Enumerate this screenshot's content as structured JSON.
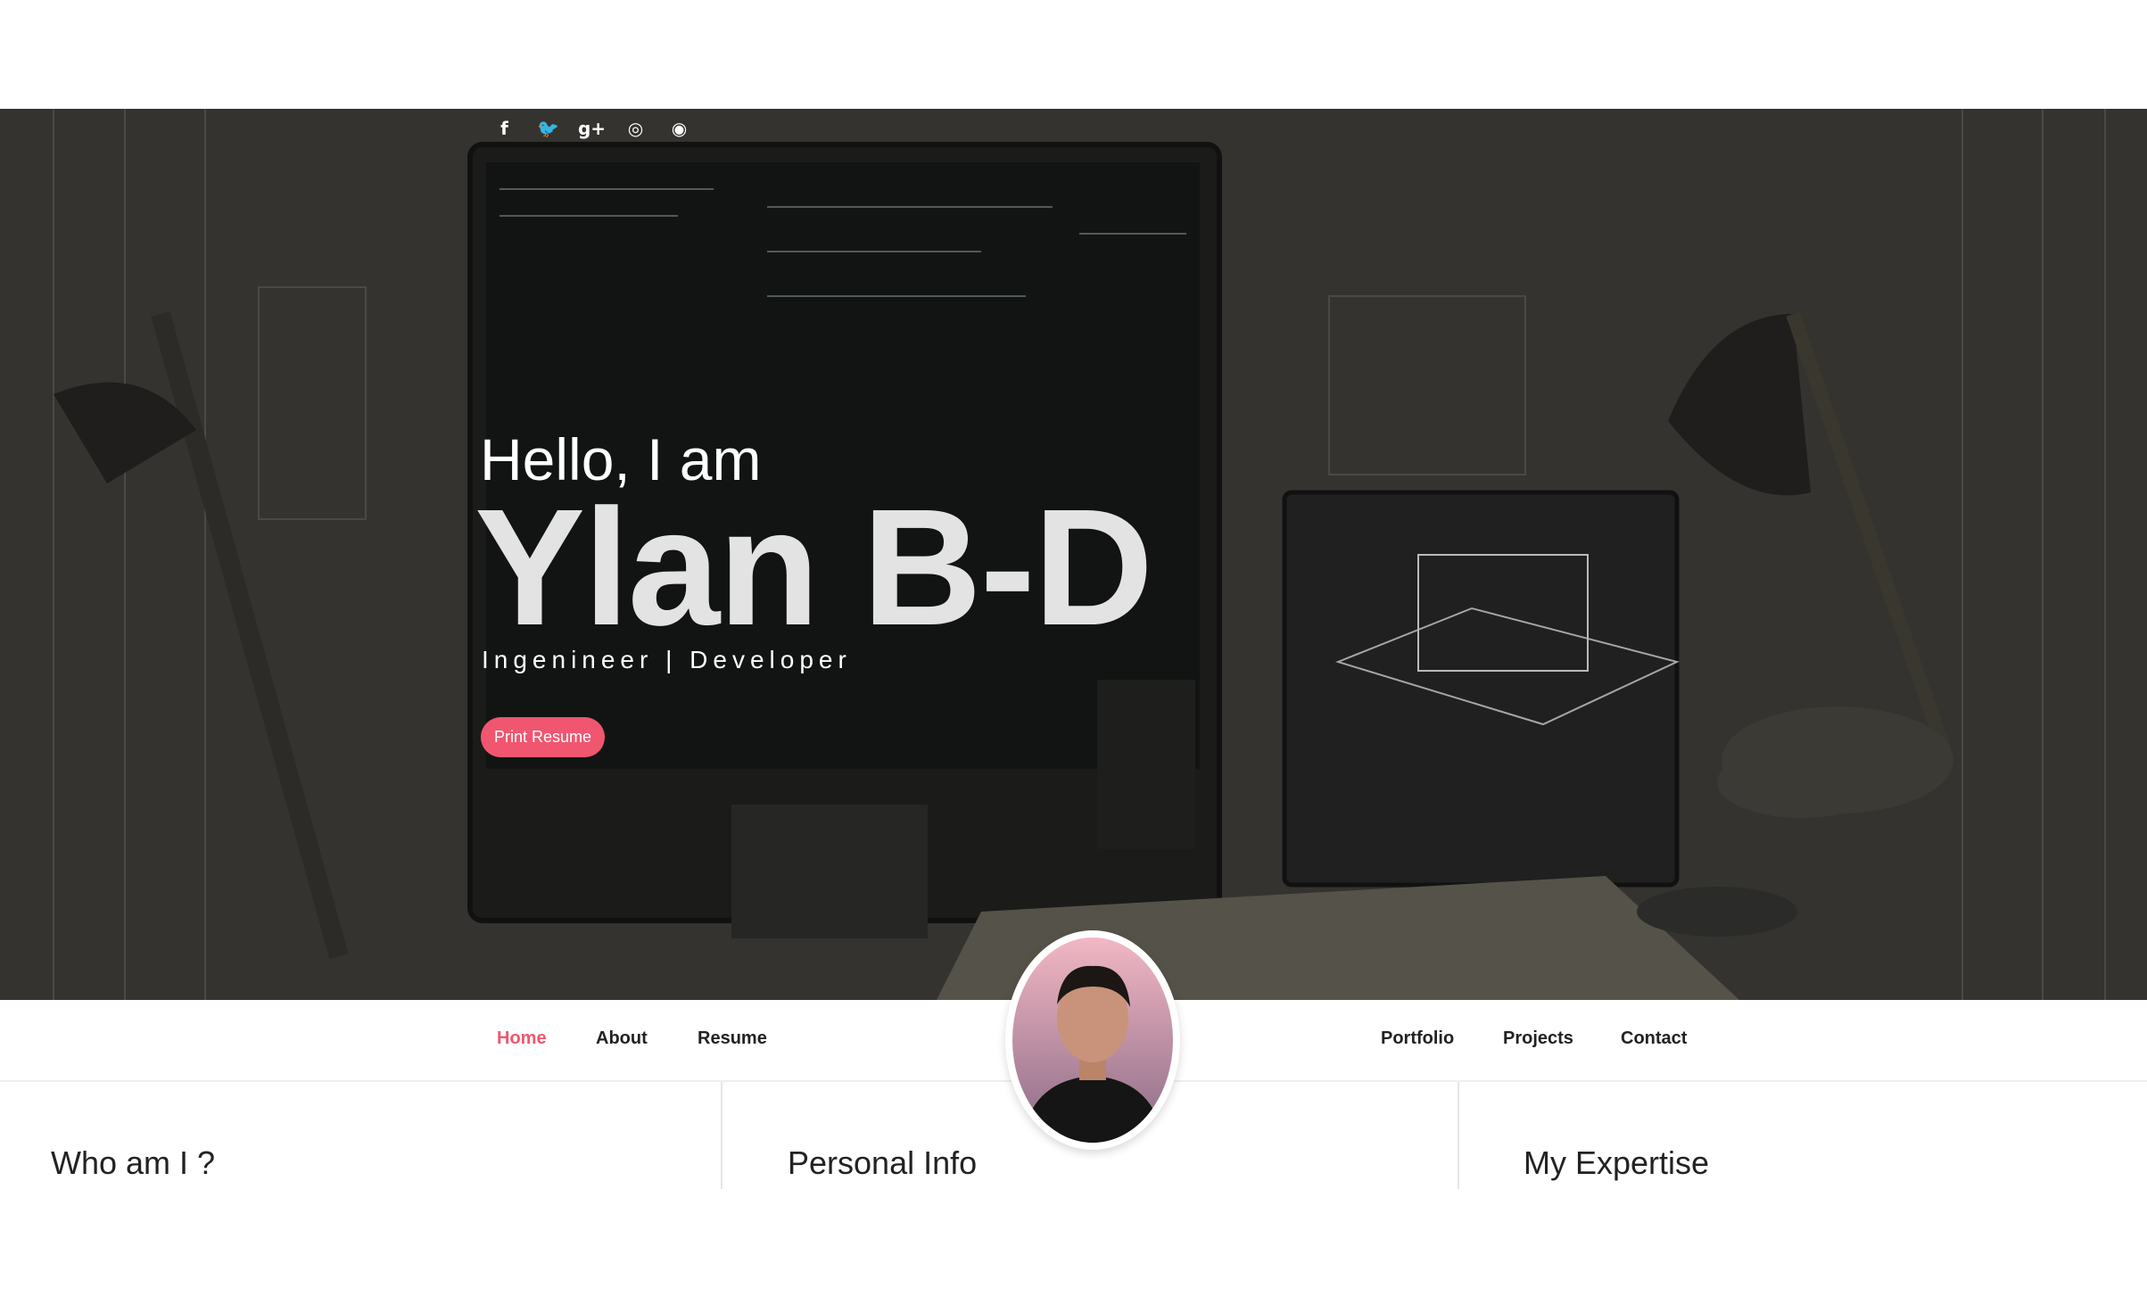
{
  "hero": {
    "greeting": "Hello, I am",
    "name": "Ylan B-D",
    "tagline": "Ingenineer | Developer",
    "print_button": "Print Resume"
  },
  "social": {
    "facebook": "f",
    "twitter": "🐦",
    "googleplus": "g+",
    "instagram": "◎",
    "github": "◉"
  },
  "nav": {
    "home": "Home",
    "about": "About",
    "resume": "Resume",
    "portfolio": "Portfolio",
    "projects": "Projects",
    "contact": "Contact"
  },
  "sections": {
    "who": "Who am I ?",
    "personal": "Personal Info",
    "expertise": "My Expertise"
  },
  "colors": {
    "accent": "#f0566f"
  }
}
